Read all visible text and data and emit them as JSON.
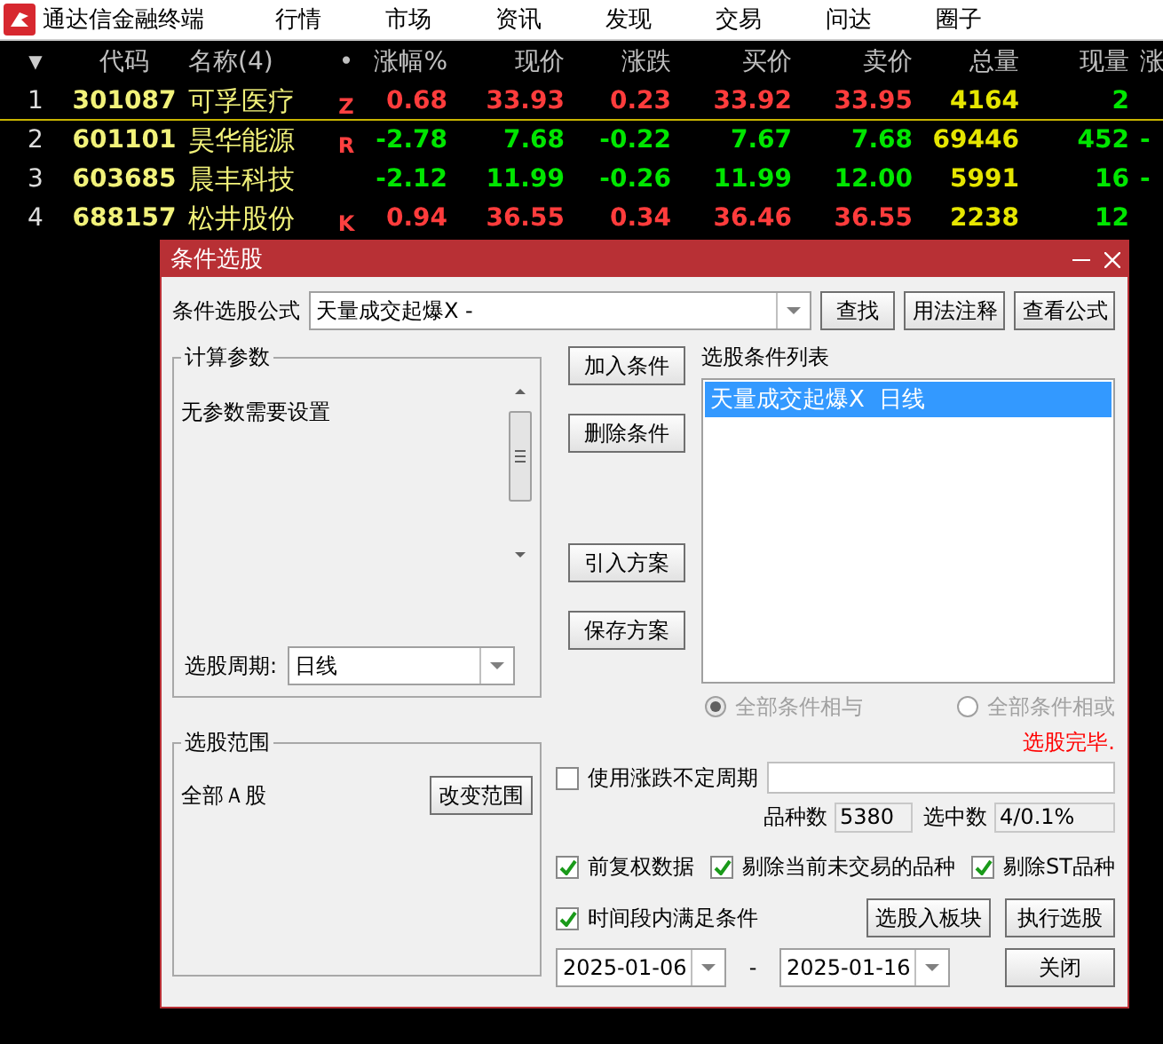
{
  "menubar": {
    "app_title": "通达信金融终端",
    "items": [
      "行情",
      "市场",
      "资讯",
      "发现",
      "交易",
      "问达",
      "圈子"
    ]
  },
  "quote_table": {
    "sort_icon": "▼",
    "columns": [
      "代码",
      "名称(4)",
      "•",
      "涨幅%",
      "现价",
      "涨跌",
      "买价",
      "卖价",
      "总量",
      "现量",
      "涨"
    ],
    "rows": [
      {
        "index": "1",
        "code": "301087",
        "name": "可孚医疗",
        "mark": "Z",
        "pct": "0.68",
        "price": "33.93",
        "change": "0.23",
        "bid": "33.92",
        "ask": "33.95",
        "volume": "4164",
        "current_volume": "2",
        "color": "#ff3c3c",
        "selected": true
      },
      {
        "index": "2",
        "code": "601101",
        "name": "昊华能源",
        "mark": "R",
        "pct": "-2.78",
        "price": "7.68",
        "change": "-0.22",
        "bid": "7.67",
        "ask": "7.68",
        "volume": "69446",
        "current_volume": "452",
        "column_12": "-",
        "color": "#00e600",
        "selected": false
      },
      {
        "index": "3",
        "code": "603685",
        "name": "晨丰科技",
        "pct": "-2.12",
        "price": "11.99",
        "change": "-0.26",
        "bid": "11.99",
        "ask": "12.00",
        "volume": "5991",
        "current_volume": "16",
        "column_12": "-",
        "color": "#00e600",
        "selected": false
      },
      {
        "index": "4",
        "code": "688157",
        "name": "松井股份",
        "mark": "K",
        "pct": "0.94",
        "price": "36.55",
        "change": "0.34",
        "bid": "36.46",
        "ask": "36.55",
        "volume": "2238",
        "current_volume": "12",
        "color": "#ff3c3c",
        "selected": false
      }
    ]
  },
  "dialog": {
    "title": "条件选股",
    "formula_label": "条件选股公式",
    "formula_value": "天量成交起爆X -",
    "top_buttons": [
      "查找",
      "用法注释",
      "查看公式"
    ],
    "params": {
      "title": "计算参数",
      "text": "无参数需要设置",
      "period_label": "选股周期:",
      "period_value": "日线"
    },
    "middle_buttons": [
      "加入条件",
      "删除条件",
      "引入方案",
      "保存方案"
    ],
    "condition_list": {
      "label": "选股条件列表",
      "items": [
        {
          "text": "天量成交起爆X  日线",
          "selected": true
        }
      ]
    },
    "radios": [
      {
        "label": "全部条件相与",
        "selected": true,
        "disabled": true
      },
      {
        "label": "全部条件相或",
        "selected": false,
        "disabled": true
      }
    ],
    "scope": {
      "title": "选股范围",
      "value": "全部Ａ股",
      "button": "改变范围"
    },
    "status": "选股完毕.",
    "variable_period": {
      "label": "使用涨跌不定周期",
      "checked": false
    },
    "counts": [
      {
        "label": "品种数",
        "value": "5380"
      },
      {
        "label": "选中数",
        "value": "4/0.1%"
      }
    ],
    "options": [
      {
        "label": "前复权数据",
        "checked": true
      },
      {
        "label": "剔除当前未交易的品种",
        "checked": true
      },
      {
        "label": "剔除ST品种",
        "checked": true
      }
    ],
    "time_range": {
      "label": "时间段内满足条件",
      "checked": true
    },
    "block_button": "选股入板块",
    "run_button": "执行选股",
    "close_button": "关闭",
    "start_date": "2025-01-06",
    "date_separator": "-",
    "end_date": "2025-01-16"
  }
}
